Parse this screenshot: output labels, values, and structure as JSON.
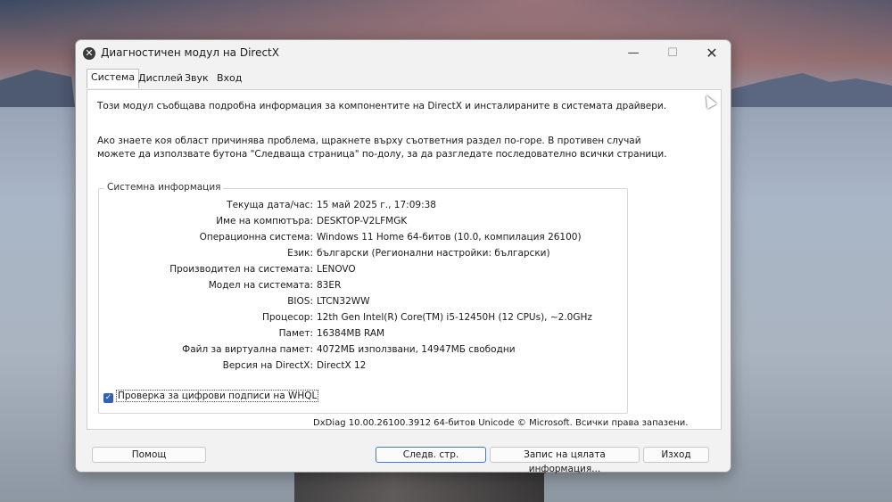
{
  "window": {
    "title": "Диагностичен модул на DirectX",
    "controls": {
      "minimize": "—",
      "maximize": "☐",
      "close": "✕"
    }
  },
  "tabs": [
    {
      "label": "Система",
      "active": true
    },
    {
      "label": "Дисплей",
      "active": false
    },
    {
      "label": "Звук",
      "active": false
    },
    {
      "label": "Вход",
      "active": false
    }
  ],
  "intro": {
    "line1": "Този модул съобщава подробна информация за компонентите на DirectX и инсталираните в системата драйвери.",
    "line2": "Ако знаете коя област причинява проблема, щракнете върху съответния раздел по-горе. В противен случай можете да използвате бутона \"Следваща страница\" по-долу, за да разгледате последователно всички страници."
  },
  "system_info": {
    "heading": "Системна информация",
    "rows": [
      {
        "label": "Текуща дата/час:",
        "value": "15 май 2025 г., 17:09:38"
      },
      {
        "label": "Име на компютъра:",
        "value": "DESKTOP-V2LFMGK"
      },
      {
        "label": "Операционна система:",
        "value": "Windows 11 Home 64-битов (10.0, компилация 26100)"
      },
      {
        "label": "Език:",
        "value": "български (Регионални настройки: български)"
      },
      {
        "label": "Производител на системата:",
        "value": "LENOVO"
      },
      {
        "label": "Модел на системата:",
        "value": "83ER"
      },
      {
        "label": "BIOS:",
        "value": "LTCN32WW"
      },
      {
        "label": "Процесор:",
        "value": "12th Gen Intel(R) Core(TM) i5-12450H (12 CPUs), ~2.0GHz"
      },
      {
        "label": "Памет:",
        "value": "16384MB RAM"
      },
      {
        "label": "Файл за виртуална памет:",
        "value": "4072МБ използвани, 14947МБ свободни"
      },
      {
        "label": "Версия на DirectX:",
        "value": "DirectX 12"
      }
    ]
  },
  "whql": {
    "label": "Проверка за цифрови подписи на WHQL",
    "checked": true
  },
  "copyright": "DxDiag 10.00.26100.3912 64-битов Unicode © Microsoft. Всички права запазени.",
  "buttons": {
    "help": "Помощ",
    "next": "Следв. стр.",
    "save": "Запис на цялата информация...",
    "exit": "Изход"
  }
}
